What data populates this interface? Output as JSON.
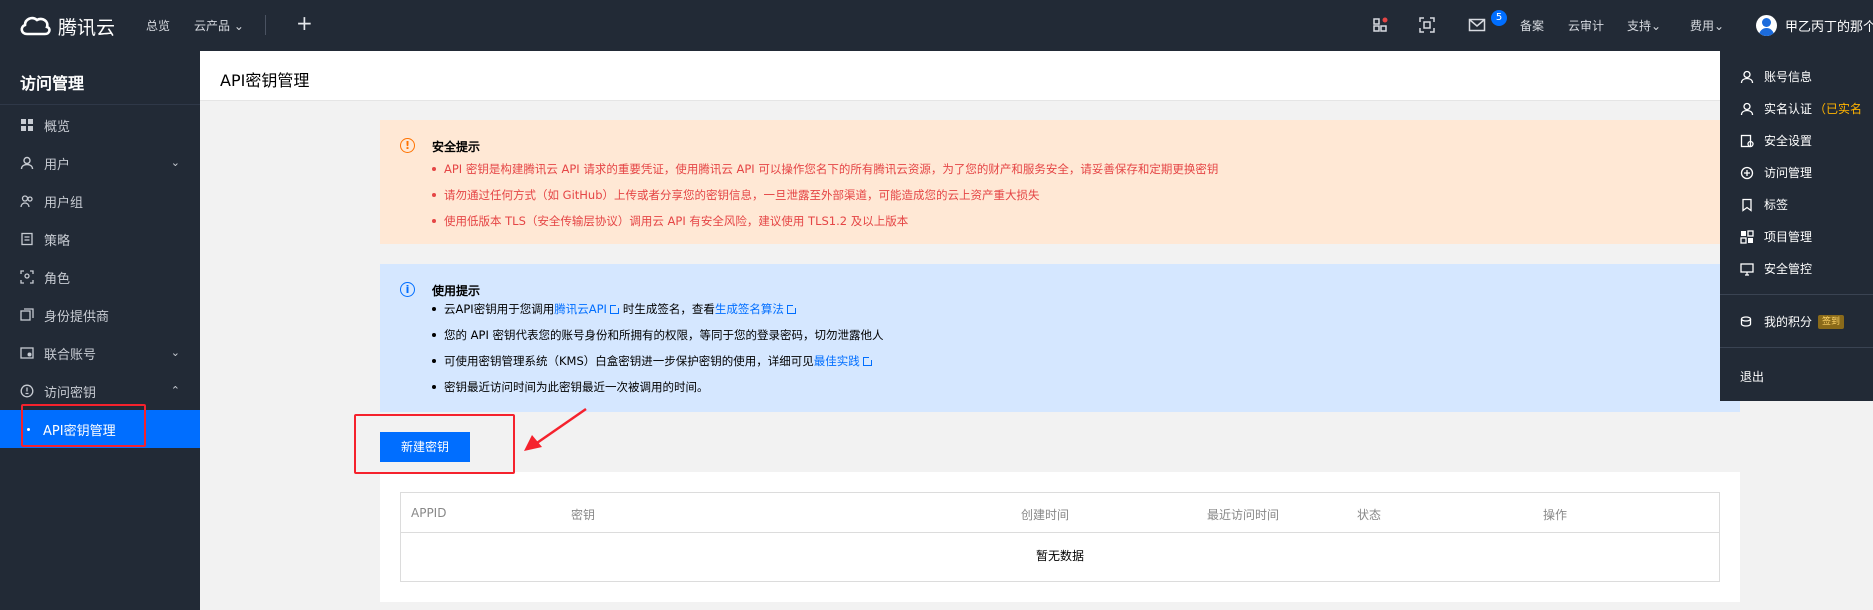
{
  "topnav": {
    "brand": "腾讯云",
    "overview": "总览",
    "products": "云产品",
    "badge_count": "5",
    "beian": "备案",
    "cloud_audit": "云审计",
    "support": "支持",
    "billing": "费用",
    "user_name": "甲乙丙丁的那个主"
  },
  "sidebar": {
    "title": "访问管理",
    "items": [
      {
        "label": "概览"
      },
      {
        "label": "用户"
      },
      {
        "label": "用户组"
      },
      {
        "label": "策略"
      },
      {
        "label": "角色"
      },
      {
        "label": "身份提供商"
      },
      {
        "label": "联合账号"
      },
      {
        "label": "访问密钥"
      },
      {
        "label": "API密钥管理"
      }
    ]
  },
  "page": {
    "title": "API密钥管理"
  },
  "security_notice": {
    "title": "安全提示",
    "items": [
      "API 密钥是构建腾讯云 API 请求的重要凭证，使用腾讯云 API 可以操作您名下的所有腾讯云资源，为了您的财产和服务安全，请妥善保存和定期更换密钥",
      "请勿通过任何方式（如 GitHub）上传或者分享您的密钥信息，一旦泄露至外部渠道，可能造成您的云上资产重大损失",
      "使用低版本 TLS（安全传输层协议）调用云 API 有安全风险，建议使用 TLS1.2 及以上版本"
    ]
  },
  "usage_notice": {
    "title": "使用提示",
    "item1_a": "云API密钥用于您调用",
    "item1_link1": "腾讯云API",
    "item1_b": "时生成签名，查看",
    "item1_link2": "生成签名算法",
    "item2": "您的 API 密钥代表您的账号身份和所拥有的权限，等同于您的登录密码，切勿泄露他人",
    "item3_a": "可使用密钥管理系统（KMS）白盒密钥进一步保护密钥的使用，详细可见",
    "item3_link": "最佳实践",
    "item4": "密钥最近访问时间为此密钥最近一次被调用的时间。"
  },
  "actions": {
    "new_key": "新建密钥"
  },
  "table": {
    "columns": [
      "APPID",
      "密钥",
      "创建时间",
      "最近访问时间",
      "状态",
      "操作"
    ],
    "empty_text": "暂无数据"
  },
  "account_menu": {
    "items": [
      {
        "label": "账号信息"
      },
      {
        "label": "实名认证",
        "extra": "（已实名"
      },
      {
        "label": "安全设置"
      },
      {
        "label": "访问管理"
      },
      {
        "label": "标签"
      },
      {
        "label": "项目管理"
      },
      {
        "label": "安全管控"
      }
    ],
    "points": "我的积分",
    "points_tag": "签到",
    "logout": "退出"
  },
  "colors": {
    "nav_bg": "#222a36",
    "primary": "#006eff",
    "warn_bg": "#ffe8d5",
    "warn_text": "#e54545",
    "info_bg": "#d5e7ff",
    "annotation": "#f5222d"
  }
}
